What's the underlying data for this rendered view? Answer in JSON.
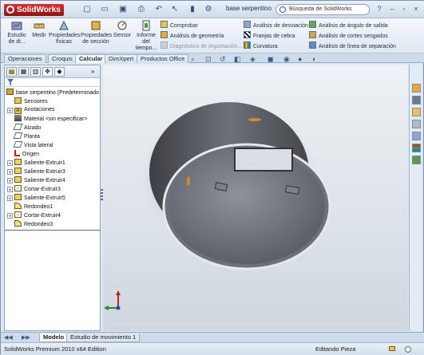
{
  "app": {
    "brand": "SolidWorks",
    "document_title": "base serpentino",
    "colors": {
      "brand_red": "#c22020",
      "accent_blue": "#3e6fb0"
    }
  },
  "search": {
    "placeholder": "Búsqueda de SolidWorks"
  },
  "quick_access": [
    "new-icon",
    "open-icon",
    "save-icon",
    "print-icon",
    "undo-icon",
    "select-icon",
    "rebuild-icon",
    "options-icon"
  ],
  "ribbon": {
    "big_buttons": [
      {
        "label": "Estudio de di...",
        "icon": "study-icon"
      },
      {
        "label": "Medir",
        "icon": "measure-icon"
      },
      {
        "label": "Propiedades físicas",
        "icon": "mass-properties-icon"
      },
      {
        "label": "Propiedades de sección",
        "icon": "section-properties-icon"
      },
      {
        "label": "Sensor",
        "icon": "sensor-icon"
      },
      {
        "label": "Informe del tiempo...",
        "icon": "report-icon"
      }
    ],
    "col1": [
      {
        "label": "Comprobar",
        "icon": "check-icon",
        "enabled": true
      },
      {
        "label": "Análisis de geometría",
        "icon": "geometry-analysis-icon",
        "enabled": true
      },
      {
        "label": "Diagnóstico de importación...",
        "icon": "import-diagnostics-icon",
        "enabled": false
      }
    ],
    "col2": [
      {
        "label": "Análisis de desviación",
        "icon": "deviation-icon"
      },
      {
        "label": "Franjas de cebra",
        "icon": "zebra-icon"
      },
      {
        "label": "Curvatura",
        "icon": "curvature-icon"
      }
    ],
    "col3": [
      {
        "label": "Análisis de ángulo de salida",
        "icon": "draft-analysis-icon"
      },
      {
        "label": "Análisis de cortes sesgados",
        "icon": "undercut-icon"
      },
      {
        "label": "Análisis de línea de separación",
        "icon": "parting-line-icon"
      }
    ]
  },
  "command_tabs": [
    "Operaciones",
    "Croquis",
    "Calcular",
    "DimXpert",
    "Productos Office"
  ],
  "active_command_tab": "Calcular",
  "feature_tree": {
    "root": "base serpentino  (Predeterminado",
    "items": [
      {
        "label": "Sensores",
        "icon": "sensors-icon",
        "expandable": false
      },
      {
        "label": "Anotaciones",
        "icon": "annotations-icon",
        "expandable": true
      },
      {
        "label": "Material <sin especificar>",
        "icon": "material-icon",
        "expandable": false
      },
      {
        "label": "Alzado",
        "icon": "plane-icon",
        "expandable": false
      },
      {
        "label": "Planta",
        "icon": "plane-icon",
        "expandable": false
      },
      {
        "label": "Vista lateral",
        "icon": "plane-icon",
        "expandable": false
      },
      {
        "label": "Origen",
        "icon": "origin-icon",
        "expandable": false
      },
      {
        "label": "Saliente-Extruir1",
        "icon": "extrude-icon",
        "expandable": true
      },
      {
        "label": "Saliente-Extruir3",
        "icon": "extrude-icon",
        "expandable": true
      },
      {
        "label": "Saliente-Extruir4",
        "icon": "extrude-icon",
        "expandable": true
      },
      {
        "label": "Cortar-Extruir3",
        "icon": "cut-extrude-icon",
        "expandable": true
      },
      {
        "label": "Saliente-Extruir5",
        "icon": "extrude-icon",
        "expandable": true
      },
      {
        "label": "Redondeo1",
        "icon": "fillet-icon",
        "expandable": false
      },
      {
        "label": "Cortar-Extruir4",
        "icon": "cut-extrude-icon",
        "expandable": true
      },
      {
        "label": "Redondeo3",
        "icon": "fillet-icon",
        "expandable": false
      }
    ]
  },
  "bottom_tabs": [
    "Modelo",
    "Estudio de movimiento 1"
  ],
  "active_bottom_tab": "Modelo",
  "status": {
    "edition": "SolidWorks Premium 2010 x64 Edition",
    "mode": "Editando Pieza"
  }
}
